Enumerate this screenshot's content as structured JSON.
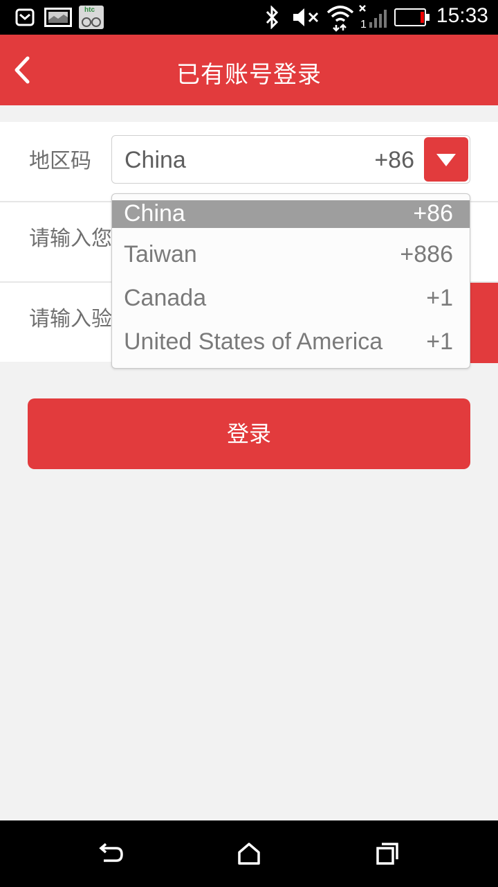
{
  "status_bar": {
    "time": "15:33",
    "icons": [
      "mail-icon",
      "image-icon",
      "htc-app-icon",
      "bluetooth-icon",
      "volume-muted-icon",
      "wifi-icon",
      "signal-icon",
      "battery-low-icon"
    ],
    "htc_label": "htc"
  },
  "header": {
    "title": "已有账号登录",
    "back_icon": "chevron-left-icon"
  },
  "form": {
    "region_label": "地区码",
    "phone_label": "请输入您",
    "code_label": "请输入验"
  },
  "region_select": {
    "selected_name": "China",
    "selected_code": "+86",
    "options": [
      {
        "name": "China",
        "code": "+86",
        "selected": true
      },
      {
        "name": "Taiwan",
        "code": "+886",
        "selected": false
      },
      {
        "name": "Canada",
        "code": "+1",
        "selected": false
      },
      {
        "name": "United States of America",
        "code": "+1",
        "selected": false
      }
    ]
  },
  "login_button": "登录",
  "nav": {
    "back": "back-icon",
    "home": "home-icon",
    "recents": "recents-icon"
  },
  "colors": {
    "accent": "#e23b3d",
    "background": "#f2f2f2",
    "selected_option": "#9e9e9e"
  }
}
